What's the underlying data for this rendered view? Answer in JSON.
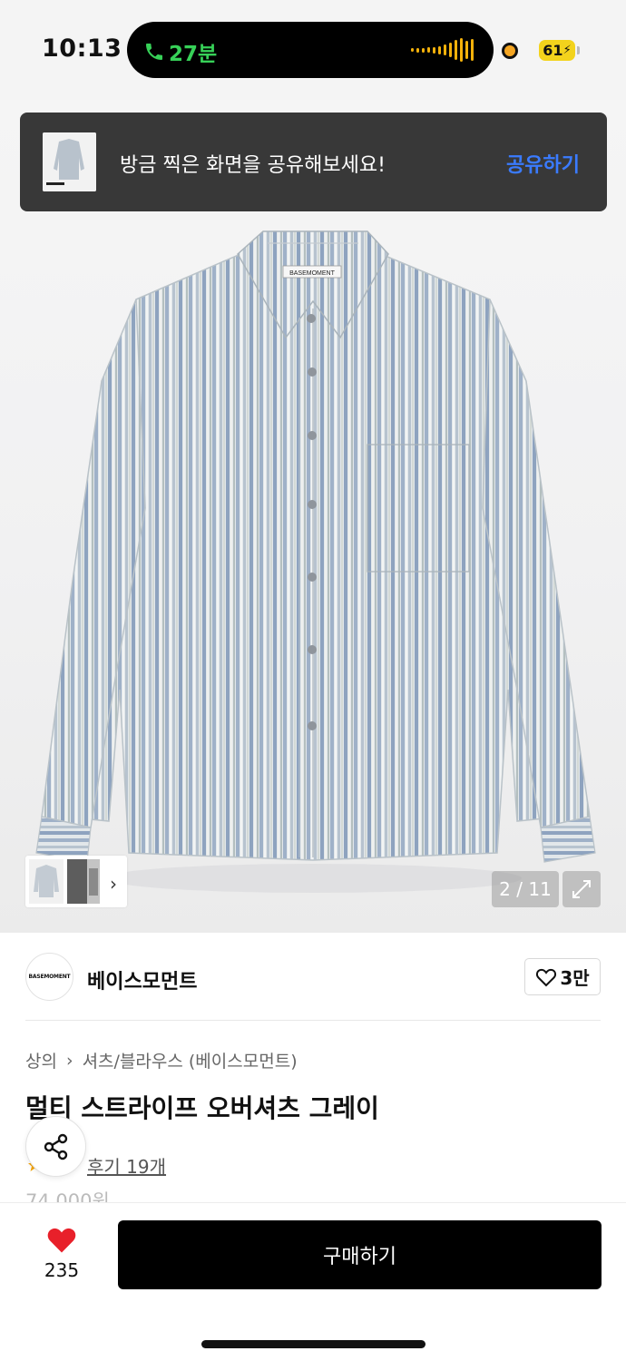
{
  "status_bar": {
    "time": "10:13",
    "call_duration": "27분",
    "battery": "61"
  },
  "share_banner": {
    "message": "방금 찍은 화면을 공유해보세요!",
    "action_label": "공유하기"
  },
  "gallery": {
    "counter": "2 / 11",
    "shirt_tag": "BASEMOMENT"
  },
  "brand": {
    "logo_text": "BASEMOMENT",
    "name": "베이스모먼트",
    "likes": "3만"
  },
  "product": {
    "breadcrumb": [
      "상의",
      "셔츠/블라우스 (베이스모먼트)"
    ],
    "title": "멀티 스트라이프 오버셔츠 그레이",
    "review_label": "후기 19개",
    "price_partial": "74,000원"
  },
  "bottom_bar": {
    "like_count": "235",
    "buy_label": "구매하기"
  },
  "colors": {
    "accent_link": "#3a7bff",
    "heart": "#e8202a",
    "call_green": "#37d158",
    "wave_orange": "#f5b20a"
  },
  "icons": [
    "phone-icon",
    "audio-wave-icon",
    "recording-dot-icon",
    "battery-icon",
    "chevron-right-icon",
    "expand-icon",
    "heart-outline-icon",
    "share-icon",
    "star-icon",
    "heart-filled-icon"
  ]
}
